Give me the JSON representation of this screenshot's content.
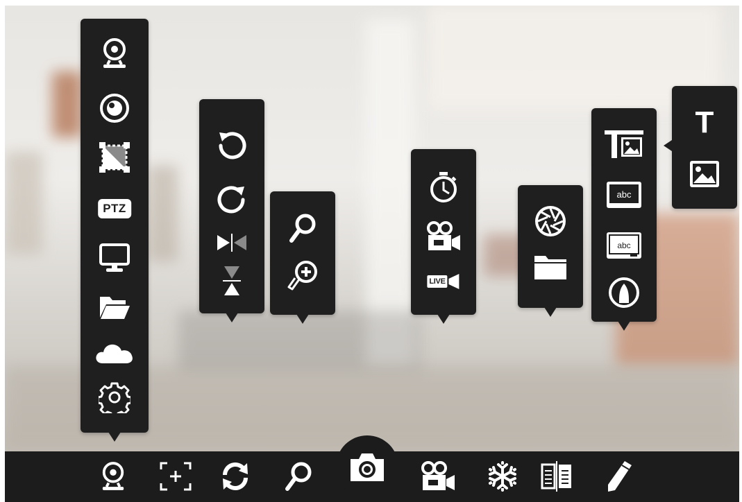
{
  "source_menu": {
    "items": [
      {
        "icon": "webcam-icon"
      },
      {
        "icon": "lens-icon"
      },
      {
        "icon": "crop-icon"
      },
      {
        "icon": "ptz-icon",
        "label": "PTZ"
      },
      {
        "icon": "monitor-icon"
      },
      {
        "icon": "folder-open-icon"
      },
      {
        "icon": "cloud-icon"
      },
      {
        "icon": "gear-icon"
      }
    ]
  },
  "rotate_menu": {
    "items": [
      {
        "icon": "rotate-ccw-icon"
      },
      {
        "icon": "rotate-cw-icon"
      },
      {
        "icon": "flip-horizontal-icon"
      },
      {
        "icon": "flip-vertical-icon"
      }
    ]
  },
  "zoom_menu": {
    "items": [
      {
        "icon": "magnifier-icon"
      },
      {
        "icon": "magnifier-plus-icon"
      }
    ]
  },
  "record_menu": {
    "items": [
      {
        "icon": "timer-icon"
      },
      {
        "icon": "video-camera-icon"
      },
      {
        "icon": "live-stream-icon",
        "label": "LIVE"
      }
    ]
  },
  "gallery_menu": {
    "items": [
      {
        "icon": "aperture-icon"
      },
      {
        "icon": "folder-icon"
      }
    ]
  },
  "annotate_menu": {
    "items": [
      {
        "icon": "text-image-icon"
      },
      {
        "icon": "chalkboard-icon",
        "label": "abc"
      },
      {
        "icon": "whiteboard-icon",
        "label": "abc"
      },
      {
        "icon": "pen-tip-icon"
      }
    ]
  },
  "insert_menu": {
    "items": [
      {
        "icon": "text-icon",
        "label": "T"
      },
      {
        "icon": "image-icon"
      }
    ]
  },
  "toolbar": {
    "items": [
      {
        "icon": "webcam-icon"
      },
      {
        "icon": "focus-icon"
      },
      {
        "icon": "rotate-icon"
      },
      {
        "icon": "zoom-icon"
      },
      {
        "icon": "capture-camera-icon"
      },
      {
        "icon": "video-camera-icon"
      },
      {
        "icon": "freeze-icon"
      },
      {
        "icon": "compare-icon"
      },
      {
        "icon": "pencil-icon"
      }
    ]
  },
  "colors": {
    "menu_bg": "#1f1f1f",
    "icon": "#ffffff",
    "toolbar_bg": "#1c1c1c"
  }
}
